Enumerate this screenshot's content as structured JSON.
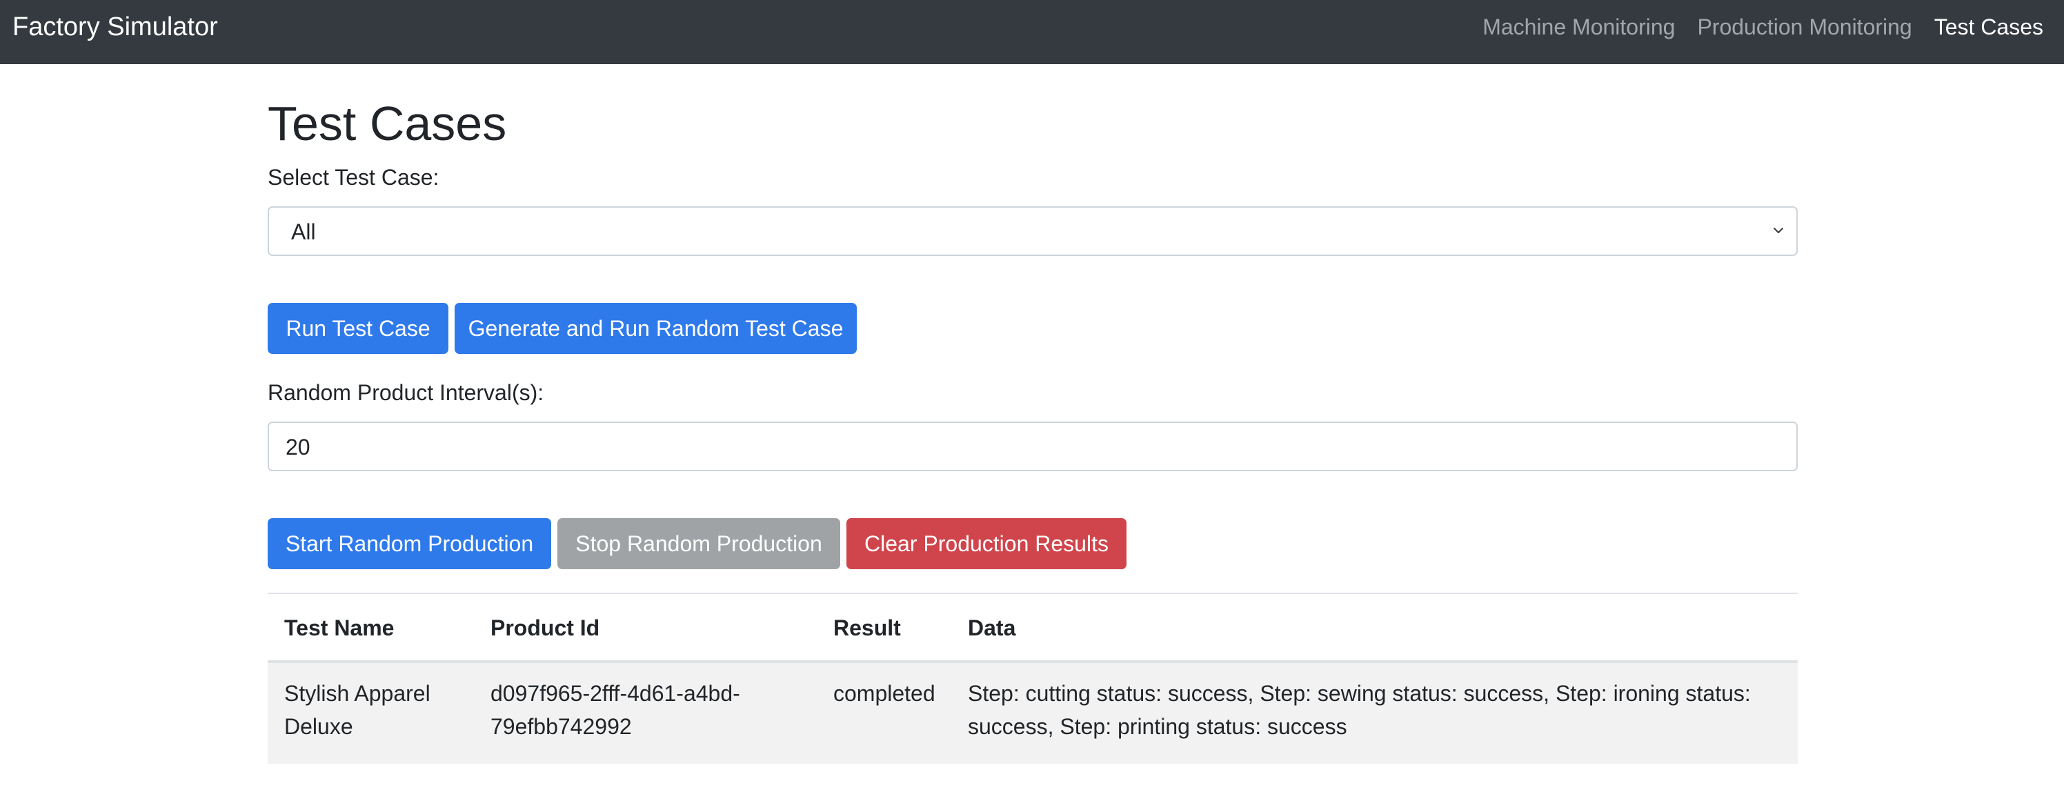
{
  "navbar": {
    "brand": "Factory Simulator",
    "links": [
      {
        "label": "Machine Monitoring",
        "active": false
      },
      {
        "label": "Production Monitoring",
        "active": false
      },
      {
        "label": "Test Cases",
        "active": true
      }
    ]
  },
  "main": {
    "title": "Test Cases",
    "select_label": "Select Test Case:",
    "select_value": "All",
    "buttons": {
      "run_test_case": "Run Test Case",
      "generate_random": "Generate and Run Random Test Case",
      "start_random": "Start Random Production",
      "stop_random": "Stop Random Production",
      "clear_results": "Clear Production Results"
    },
    "interval_label": "Random Product Interval(s):",
    "interval_value": "20"
  },
  "table": {
    "headers": [
      "Test Name",
      "Product Id",
      "Result",
      "Data"
    ],
    "rows": [
      {
        "test_name_line1": "Stylish Apparel",
        "test_name_line2": "Deluxe",
        "product_id_line1": "d097f965-2fff-4d61-a4bd-",
        "product_id_line2": "79efbb742992",
        "result": "completed",
        "data_line1": "Step: cutting status: success, Step: sewing status: success, Step: ironing status:",
        "data_line2": "success, Step: printing status: success"
      }
    ]
  },
  "colors": {
    "navbar_bg": "#343a40",
    "primary": "#2f7aeb",
    "secondary": "#9fa3a6",
    "danger": "#d0454c",
    "row_striped": "#f2f2f2"
  },
  "icons": {
    "select_caret": "chevron-down-icon"
  }
}
